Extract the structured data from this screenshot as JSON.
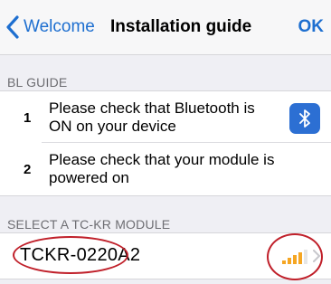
{
  "navbar": {
    "back_label": "Welcome",
    "title": "Installation guide",
    "ok_label": "OK",
    "accent_color": "#1e6fd0"
  },
  "guide": {
    "header": "BL GUIDE",
    "steps": [
      {
        "number": "1",
        "text": "Please check that Bluetooth is ON on your device",
        "icon": "bluetooth-icon"
      },
      {
        "number": "2",
        "text": "Please check that your module is powered on"
      }
    ]
  },
  "modules": {
    "header": "SELECT A TC-KR MODULE",
    "items": [
      {
        "name": "TCKR-0220A2",
        "signal_bars": 4,
        "signal_max": 5,
        "signal_color": "#f5a623"
      }
    ]
  },
  "annotation_color": "#c0202a"
}
